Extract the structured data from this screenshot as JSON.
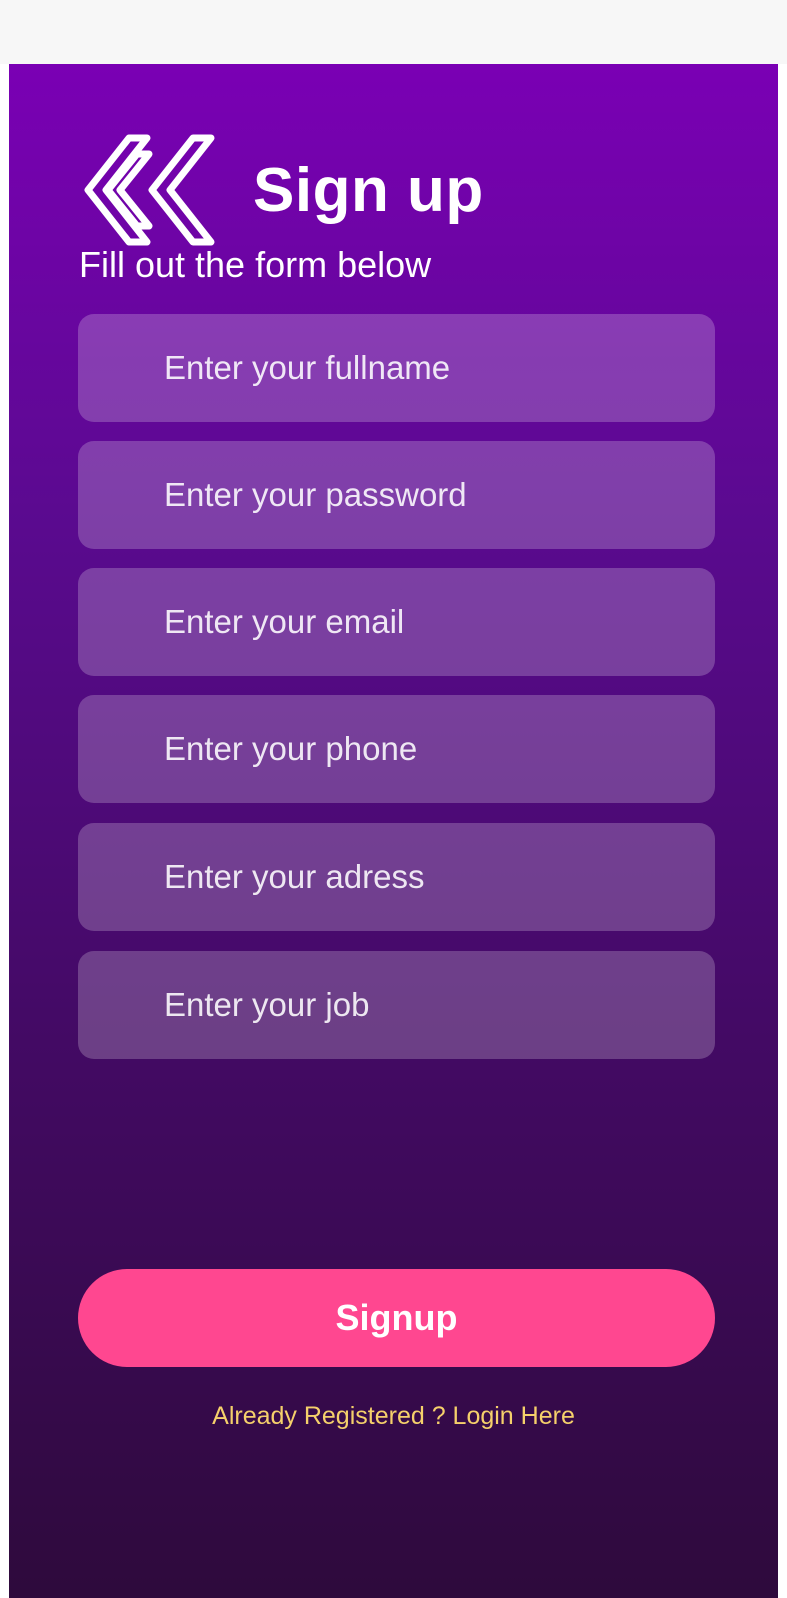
{
  "header": {
    "back_icon": "double-chevron-left-icon",
    "title": "Sign up",
    "subtitle": "Fill out the form below"
  },
  "form": {
    "fields": [
      {
        "name": "fullname-field",
        "placeholder": "Enter your fullname",
        "value": ""
      },
      {
        "name": "password-field",
        "placeholder": "Enter your password",
        "value": ""
      },
      {
        "name": "email-field",
        "placeholder": "Enter your email",
        "value": ""
      },
      {
        "name": "phone-field",
        "placeholder": "Enter your phone",
        "value": ""
      },
      {
        "name": "address-field",
        "placeholder": "Enter your adress",
        "value": ""
      },
      {
        "name": "job-field",
        "placeholder": "Enter your job",
        "value": ""
      }
    ],
    "submit_label": "Signup",
    "login_link": "Already Registered ? Login Here"
  },
  "colors": {
    "gradient_top": "#7a00b4",
    "gradient_bottom": "#2e0a3c",
    "button": "#ff4790",
    "link": "#f5d06b"
  }
}
